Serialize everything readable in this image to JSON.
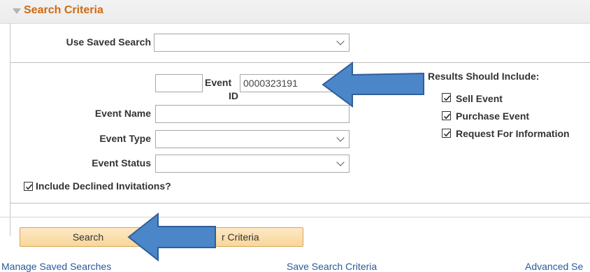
{
  "header": {
    "title": "Search Criteria"
  },
  "saved_search": {
    "label": "Use Saved Search",
    "value": ""
  },
  "event_id": {
    "prefix_value": "",
    "label_line1": "Event",
    "label_line2": "ID",
    "value": "0000323191"
  },
  "event_name": {
    "label": "Event Name",
    "value": ""
  },
  "event_type": {
    "label": "Event Type",
    "value": ""
  },
  "event_status": {
    "label": "Event Status",
    "value": ""
  },
  "include_declined": {
    "label": "Include Declined Invitations?",
    "checked": true
  },
  "results": {
    "heading": "Results Should Include:",
    "options": [
      {
        "label": "Sell Event",
        "checked": true
      },
      {
        "label": "Purchase Event",
        "checked": true
      },
      {
        "label": "Request For Information",
        "checked": true
      }
    ]
  },
  "buttons": {
    "search": "Search",
    "clear": "r Criteria"
  },
  "links": {
    "manage": "Manage Saved Searches",
    "save": "Save Search Criteria",
    "advanced": "Advanced Se"
  },
  "colors": {
    "header_title": "#d06a10",
    "arrow": "#4a86c8",
    "link": "#2b5a9c",
    "button": "#fbdfab"
  }
}
